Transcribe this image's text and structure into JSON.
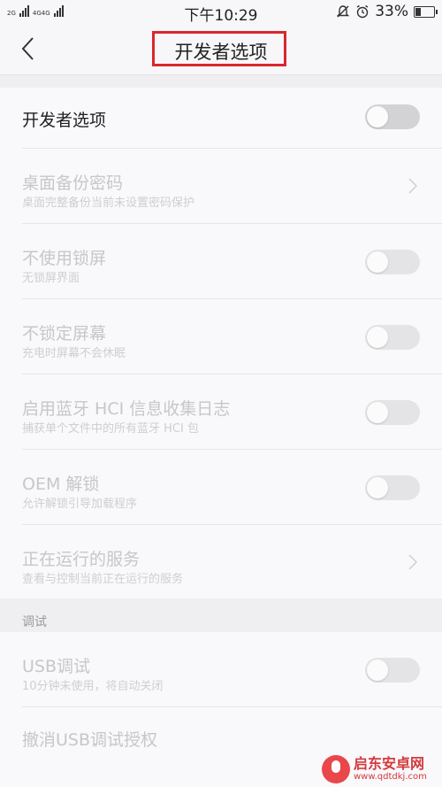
{
  "status_bar": {
    "network_label_1": "4G4G",
    "network_label_2": "2G",
    "time": "下午10:29",
    "battery": "33%",
    "battery_level": 0.33
  },
  "header": {
    "title": "开发者选项"
  },
  "master": {
    "label": "开发者选项",
    "enabled": false
  },
  "settings": [
    {
      "title": "桌面备份密码",
      "subtitle": "桌面完整备份当前未设置密码保护",
      "control": "chevron-right-icon"
    },
    {
      "title": "不使用锁屏",
      "subtitle": "无锁屏界面",
      "control": "toggle"
    },
    {
      "title": "不锁定屏幕",
      "subtitle": "充电时屏幕不会休眠",
      "control": "toggle"
    },
    {
      "title": "启用蓝牙 HCI 信息收集日志",
      "subtitle": "捕获单个文件中的所有蓝牙 HCI 包",
      "control": "toggle"
    },
    {
      "title": "OEM 解锁",
      "subtitle": "允许解锁引导加载程序",
      "control": "toggle"
    },
    {
      "title": "正在运行的服务",
      "subtitle": "查看与控制当前正在运行的服务",
      "control": "chevron-right-icon"
    }
  ],
  "debug_section": {
    "header": "调试",
    "items": [
      {
        "title": "USB调试",
        "subtitle": "10分钟未使用，将自动关闭",
        "control": "toggle"
      },
      {
        "title": "撤消USB调试授权",
        "subtitle": "",
        "control": "none"
      }
    ]
  },
  "watermark": {
    "name": "启东安卓网",
    "url": "www.qdtdkj.com"
  }
}
